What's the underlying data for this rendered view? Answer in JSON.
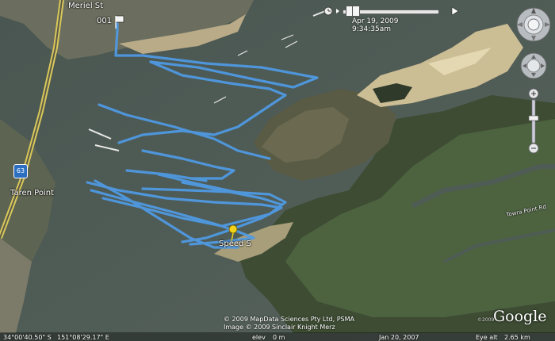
{
  "map": {
    "labels": {
      "meriel_st": "Meriel St",
      "taren_point": "Taren Point",
      "towra_point_rd": "Towra Point Rd",
      "point_001": "001",
      "speed_marker": "Speed S",
      "route_shield": "63"
    }
  },
  "time_slider": {
    "date": "Apr 19, 2009",
    "time": "9:34:35am"
  },
  "copyright": {
    "line1": "© 2009 MapData Sciences Pty Ltd, PSMA",
    "line2": "Image © 2009 Sinclair Knight Merz"
  },
  "status_bar": {
    "lat": "34°00'40.50\" S",
    "lon": "151°08'29.17\" E",
    "elev_label": "elev",
    "elev_value": "0 m",
    "imagery_date": "Jan 20, 2007",
    "eye_alt_label": "Eye alt",
    "eye_alt_value": "2.65 km"
  },
  "branding": {
    "google": "Google",
    "small": "©2009"
  },
  "colors": {
    "track": "#4f9be6",
    "water": "#4b5852",
    "land_dark": "#3a4a30",
    "sand": "#d8c9a2",
    "marker": "#f2d21a"
  },
  "icons": {
    "nav": "compass-icon",
    "look": "look-joystick-icon",
    "move": "move-joystick-icon",
    "zoom_in": "zoom-in-icon",
    "zoom_out": "zoom-out-icon",
    "placemark": "pushpin-icon"
  }
}
